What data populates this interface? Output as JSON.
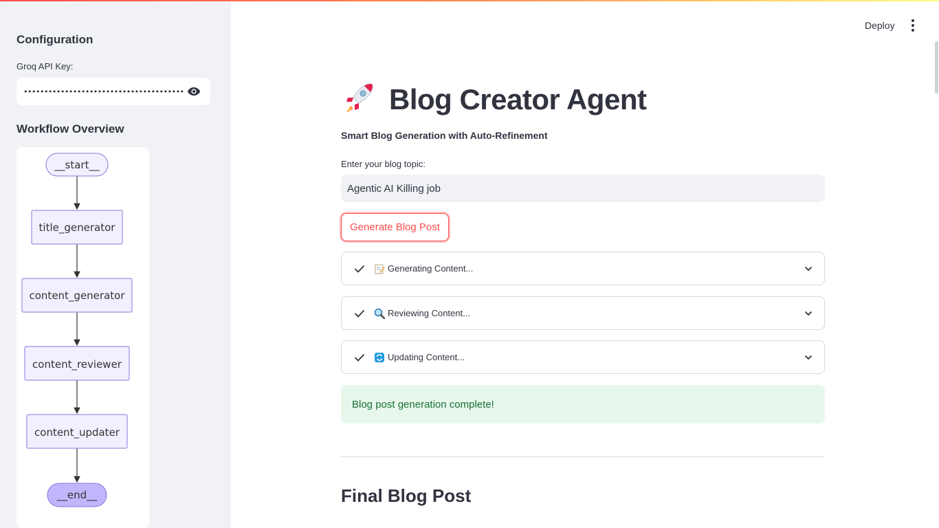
{
  "header": {
    "deploy_label": "Deploy",
    "menu_icon": "kebab-menu-icon"
  },
  "colors": {
    "accent": "#ff4b4b",
    "sidebar_bg": "#f0f2f6",
    "node_fill": "#f2f0ff",
    "node_stroke": "#9370db",
    "end_node_fill": "#bfb6fc",
    "success_bg": "#e8f7ec",
    "success_text": "#177233"
  },
  "sidebar": {
    "config_heading": "Configuration",
    "api_key_label": "Groq API Key:",
    "api_key_value": "••••••••••••••••••••••••••••••••••••••••••",
    "workflow_heading": "Workflow Overview",
    "workflow_nodes": [
      "__start__",
      "title_generator",
      "content_generator",
      "content_reviewer",
      "content_updater",
      "__end__"
    ]
  },
  "main": {
    "title_icon": "rocket-icon",
    "title": "Blog Creator Agent",
    "subtitle": "Smart Blog Generation with Auto-Refinement",
    "topic_label": "Enter your blog topic:",
    "topic_value": "Agentic AI Killing job",
    "generate_button": "Generate Blog Post",
    "steps": [
      {
        "icon": "memo-icon",
        "label": "Generating Content...",
        "status": "complete"
      },
      {
        "icon": "magnifier-icon",
        "label": "Reviewing Content...",
        "status": "complete"
      },
      {
        "icon": "refresh-icon",
        "label": "Updating Content...",
        "status": "complete"
      }
    ],
    "success_message": "Blog post generation complete!",
    "final_heading": "Final Blog Post"
  }
}
